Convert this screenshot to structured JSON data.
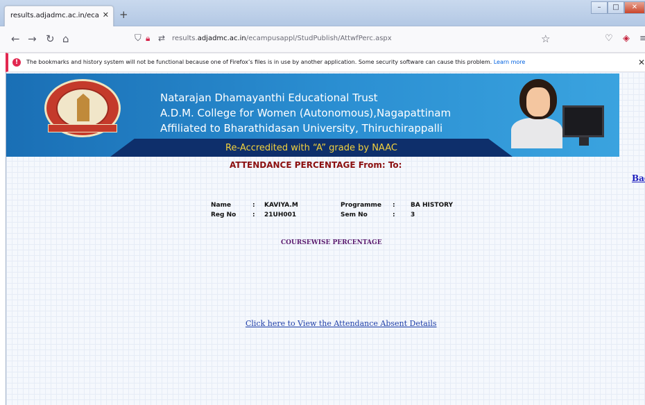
{
  "browser": {
    "tab_title": "results.adjadmc.ac.in/ecampusappl",
    "tab_close": "✕",
    "new_tab": "+",
    "url_prefix": "results.",
    "url_domain": "adjadmc.ac.in",
    "url_path": "/ecampusappl/StudPublish/AttwfPerc.aspx",
    "icons": [
      "back-icon",
      "forward-icon",
      "reload-icon",
      "home-icon",
      "shield-icon",
      "lock-icon",
      "permissions-icon",
      "bookmark-star-icon",
      "pocket-icon",
      "extension-icon",
      "menu-icon"
    ]
  },
  "notification": {
    "icon": "!",
    "message": "The bookmarks and history system will not be functional because one of Firefox’s files is in use by another application. Some security software can cause this problem.",
    "link": "Learn more",
    "close": "✕"
  },
  "banner": {
    "line1": "Natarajan Dhamayanthi Educational Trust",
    "line2": "A.D.M. College for Women (Autonomous),Nagapattinam",
    "line3": "Affiliated to Bharathidasan University, Thiruchirappalli",
    "accreditation": "Re-Accredited with “A” grade by NAAC"
  },
  "page": {
    "heading": "ATTENDANCE PERCENTAGE From:   To:",
    "back_link": "Back",
    "student": {
      "name_label": "Name",
      "name_value": "KAVIYA.M",
      "regno_label": "Reg No",
      "regno_value": "21UH001",
      "programme_label": "Programme",
      "programme_value": "BA HISTORY",
      "semno_label": "Sem No",
      "semno_value": "3",
      "colon": ":"
    },
    "coursewise_label": "COURSEWISE PERCENTAGE",
    "absent_link": "Click here to View the Attendance Absent Details"
  },
  "colors": {
    "heading": "#8b0f0f",
    "banner_blue": "#1a6fb5",
    "accreditation_text": "#f4d23c",
    "link": "#1f3fa8"
  }
}
